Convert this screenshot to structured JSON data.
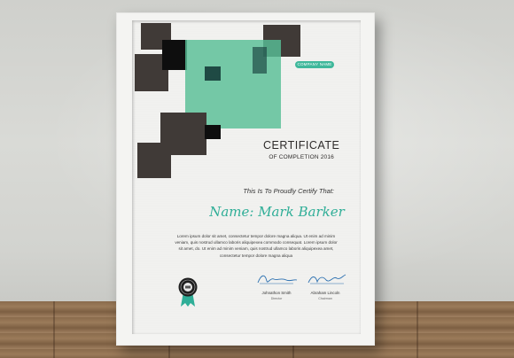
{
  "certificate": {
    "company_badge": "COMPANY NAME",
    "title": "CERTIFICATE",
    "subtitle": "OF COMPLETION 2016",
    "certify_line": "This Is To Proudly Certify That:",
    "name_line": "Name: Mark Barker",
    "body_text": "Lorem ipsum dolor sit amet, consectetur tempor dolore magna aliqua. Ut enim ad minim veniam, quis nostrud ullamco laboris aliquipexea commodo consequat. Lorem ipsum dolor sit amet, do. Ut enim ad minim veniam, quis nostrud ullamco laboris aliquipexea amet, consectetur tempor dolore magna aliqua",
    "signatures": [
      {
        "name": "Johnathon Smith",
        "role": "Director"
      },
      {
        "name": "Abraham Lincoln",
        "role": "Chairman"
      }
    ],
    "colors": {
      "accent": "#3fb89b",
      "dark_squares": "#403a37",
      "frame": "#f4f4f2"
    }
  }
}
